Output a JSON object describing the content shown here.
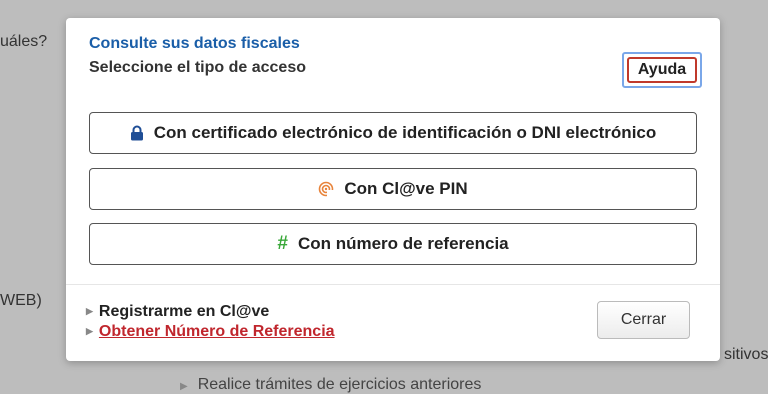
{
  "background": {
    "question_fragment": "uáles?",
    "web_fragment": "WEB)",
    "dispositivos_fragment": "sitivos",
    "ejercicios_text": "Realice trámites de ejercicios anteriores"
  },
  "modal": {
    "title": "Consulte sus datos fiscales",
    "subtitle": "Seleccione el tipo de acceso",
    "help_label": "Ayuda",
    "access_options": [
      {
        "label": "Con certificado electrónico de identificación o DNI electrónico",
        "icon": "lock-icon"
      },
      {
        "label": "Con Cl@ve PIN",
        "icon": "clave-pin-icon"
      },
      {
        "label": "Con número de referencia",
        "icon": "hash-icon"
      }
    ],
    "links": {
      "register": "Registrarme en Cl@ve",
      "reference_number": "Obtener Número de Referencia"
    },
    "close_label": "Cerrar"
  },
  "colors": {
    "title": "#1a5ea8",
    "link_red": "#c0262d",
    "hash_green": "#3aa83a",
    "clave_orange": "#e8833a",
    "lock_blue": "#1f4e96"
  }
}
